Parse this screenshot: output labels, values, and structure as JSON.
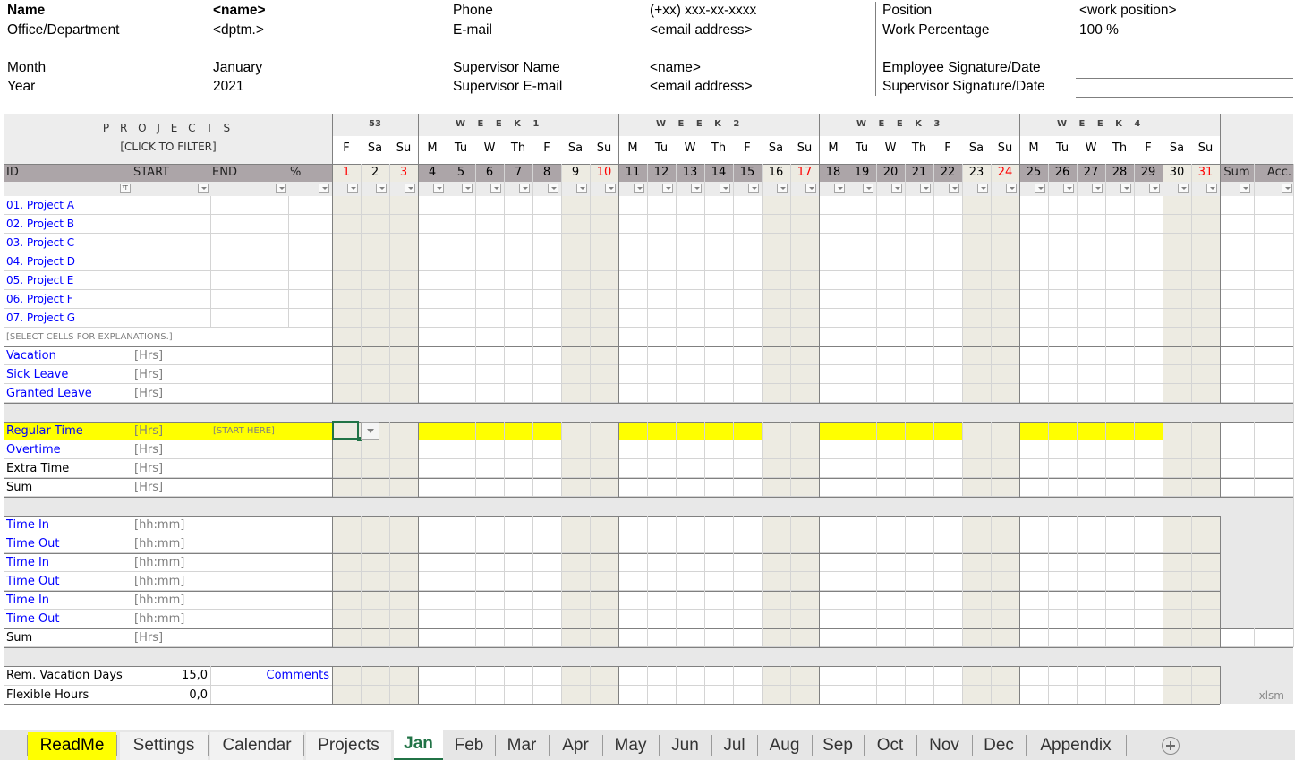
{
  "header": {
    "col1": [
      {
        "label": "Name",
        "value": "<name>",
        "bold": true
      },
      {
        "label": "Office/Department",
        "value": "<dptm.>"
      },
      {
        "label": "Month",
        "value": "January"
      },
      {
        "label": "Year",
        "value": "2021"
      }
    ],
    "col2": [
      {
        "label": "Phone",
        "value": "(+xx) xxx-xx-xxxx"
      },
      {
        "label": "E-mail",
        "value": "<email address>"
      },
      {
        "label": "Supervisor Name",
        "value": "<name>"
      },
      {
        "label": "Supervisor E-mail",
        "value": "<email address>"
      }
    ],
    "col3": [
      {
        "label": "Position",
        "value": "<work position>"
      },
      {
        "label": "Work Percentage",
        "value": "100 %"
      },
      {
        "label": "Employee Signature/Date",
        "value": ""
      },
      {
        "label": "Supervisor Signature/Date",
        "value": ""
      }
    ]
  },
  "table": {
    "projects_title": "P R O J E C T S",
    "projects_subtitle": "[CLICK TO FILTER]",
    "columns": {
      "id": "ID",
      "start": "START",
      "end": "END",
      "pct": "%",
      "sum": "Sum",
      "acc": "Acc."
    },
    "weeks": [
      {
        "label": "53",
        "days": 3
      },
      {
        "label": "W  E  E  K  1",
        "days": 7
      },
      {
        "label": "W  E  E  K  2",
        "days": 7
      },
      {
        "label": "W  E  E  K  3",
        "days": 7
      },
      {
        "label": "W  E  E  K  4",
        "days": 7
      }
    ],
    "days": [
      {
        "n": "1",
        "d": "F",
        "weekend": true,
        "red": true
      },
      {
        "n": "2",
        "d": "Sa",
        "weekend": true,
        "red": false
      },
      {
        "n": "3",
        "d": "Su",
        "weekend": true,
        "red": true
      },
      {
        "n": "4",
        "d": "M"
      },
      {
        "n": "5",
        "d": "Tu"
      },
      {
        "n": "6",
        "d": "W"
      },
      {
        "n": "7",
        "d": "Th"
      },
      {
        "n": "8",
        "d": "F"
      },
      {
        "n": "9",
        "d": "Sa",
        "weekend": true
      },
      {
        "n": "10",
        "d": "Su",
        "weekend": true,
        "red": true
      },
      {
        "n": "11",
        "d": "M"
      },
      {
        "n": "12",
        "d": "Tu"
      },
      {
        "n": "13",
        "d": "W"
      },
      {
        "n": "14",
        "d": "Th"
      },
      {
        "n": "15",
        "d": "F"
      },
      {
        "n": "16",
        "d": "Sa",
        "weekend": true
      },
      {
        "n": "17",
        "d": "Su",
        "weekend": true,
        "red": true
      },
      {
        "n": "18",
        "d": "M"
      },
      {
        "n": "19",
        "d": "Tu"
      },
      {
        "n": "20",
        "d": "W"
      },
      {
        "n": "21",
        "d": "Th"
      },
      {
        "n": "22",
        "d": "F"
      },
      {
        "n": "23",
        "d": "Sa",
        "weekend": true
      },
      {
        "n": "24",
        "d": "Su",
        "weekend": true,
        "red": true
      },
      {
        "n": "25",
        "d": "M"
      },
      {
        "n": "26",
        "d": "Tu"
      },
      {
        "n": "27",
        "d": "W"
      },
      {
        "n": "28",
        "d": "Th"
      },
      {
        "n": "29",
        "d": "F"
      },
      {
        "n": "30",
        "d": "Sa",
        "weekend": true
      },
      {
        "n": "31",
        "d": "Su",
        "weekend": true,
        "red": true
      }
    ],
    "projects": [
      "01. Project A",
      "02. Project B",
      "03. Project C",
      "04. Project D",
      "05. Project E",
      "06. Project F",
      "07. Project G"
    ],
    "explanation_hint": "[SELECT CELLS FOR EXPLANATIONS.]",
    "leave_rows": [
      {
        "label": "Vacation",
        "unit": "[Hrs]"
      },
      {
        "label": "Sick Leave",
        "unit": "[Hrs]"
      },
      {
        "label": "Granted Leave",
        "unit": "[Hrs]"
      }
    ],
    "time_rows": [
      {
        "label": "Regular Time",
        "unit": "[Hrs]",
        "hint": "[START HERE]",
        "highlight": true,
        "blue": true
      },
      {
        "label": "Overtime",
        "unit": "[Hrs]",
        "blue": true
      },
      {
        "label": "Extra Time",
        "unit": "[Hrs]"
      },
      {
        "label": "Sum",
        "unit": "[Hrs]"
      }
    ],
    "clock_rows": [
      {
        "label": "Time In",
        "unit": "[hh:mm]",
        "blue": true
      },
      {
        "label": "Time Out",
        "unit": "[hh:mm]",
        "blue": true
      },
      {
        "label": "Time In",
        "unit": "[hh:mm]",
        "blue": true
      },
      {
        "label": "Time Out",
        "unit": "[hh:mm]",
        "blue": true
      },
      {
        "label": "Time In",
        "unit": "[hh:mm]",
        "blue": true
      },
      {
        "label": "Time Out",
        "unit": "[hh:mm]",
        "blue": true
      },
      {
        "label": "Sum",
        "unit": "[Hrs]"
      }
    ],
    "summary": [
      {
        "label": "Rem. Vacation Days",
        "value": "15,0"
      },
      {
        "label": "Flexible Hours",
        "value": "0,0"
      }
    ],
    "comments_label": "Comments",
    "file_type": "xlsm"
  },
  "sheet_tabs": [
    {
      "label": "ReadMe",
      "highlight": true
    },
    {
      "label": "Settings"
    },
    {
      "label": "Calendar"
    },
    {
      "label": "Projects"
    },
    {
      "label": "Jan",
      "active": true
    },
    {
      "label": "Feb"
    },
    {
      "label": "Mar"
    },
    {
      "label": "Apr"
    },
    {
      "label": "May"
    },
    {
      "label": "Jun"
    },
    {
      "label": "Jul"
    },
    {
      "label": "Aug"
    },
    {
      "label": "Sep"
    },
    {
      "label": "Oct"
    },
    {
      "label": "Nov"
    },
    {
      "label": "Dec"
    },
    {
      "label": "Appendix"
    }
  ],
  "colors": {
    "header_band": "#ededed",
    "col_header_bg": "#aca5a8",
    "weekend_bg": "#edebe2",
    "highlight_yellow": "#ffff00",
    "blue_text": "#0000ff",
    "red_day": "#ff0000",
    "active_tab_text": "#217346",
    "section_gap": "#e8e8e8"
  }
}
